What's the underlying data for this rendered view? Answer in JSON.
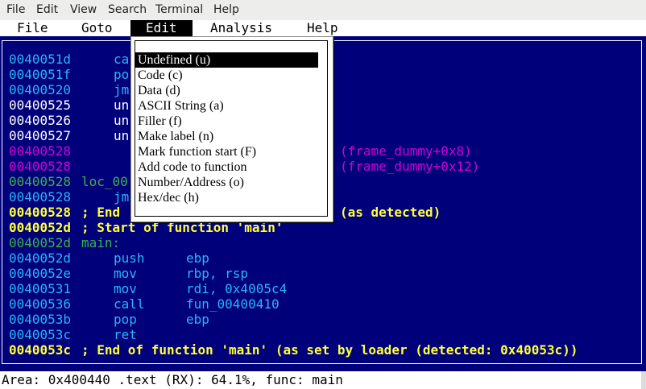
{
  "terminal_menu": [
    "File",
    "Edit",
    "View",
    "Search",
    "Terminal",
    "Help"
  ],
  "app_menu": [
    "File",
    "Goto",
    "Edit",
    "Analysis",
    "Help"
  ],
  "app_menu_active": "Edit",
  "edit_menu": [
    "Undefined (u)",
    "Code (c)",
    "Data (d)",
    "ASCII String (a)",
    "Filler (f)",
    "Make label (n)",
    "Mark function start (F)",
    "Add code to function",
    "Number/Address (o)",
    "Hex/dec (h)"
  ],
  "edit_menu_selected": "Undefined (u)",
  "listing": [
    {
      "addr": "0040051d",
      "text": "ca"
    },
    {
      "addr": "0040051f",
      "text": "po"
    },
    {
      "addr": "00400520",
      "text": "jm"
    },
    {
      "addr": "00400525",
      "text": "un"
    },
    {
      "addr": "00400526",
      "text": "un"
    },
    {
      "addr": "00400527",
      "text": "un"
    },
    {
      "addr": "00400528",
      "text": "(frame_dummy+0x8)"
    },
    {
      "addr": "00400528",
      "text": "(frame_dummy+0x12)"
    },
    {
      "addr": "00400528",
      "text": "loc_00"
    },
    {
      "addr": "00400528",
      "text": "jm"
    },
    {
      "addr": "00400528",
      "text": "; End",
      "tail": "(as detected)"
    },
    {
      "addr": "0040052d",
      "text": "; Start of function 'main'"
    },
    {
      "addr": "0040052d",
      "text": "main:"
    },
    {
      "addr": "0040052d",
      "mnem": "push",
      "ops": "ebp"
    },
    {
      "addr": "0040052e",
      "mnem": "mov",
      "ops": "rbp, rsp"
    },
    {
      "addr": "00400531",
      "mnem": "mov",
      "ops": "rdi, 0x4005c4"
    },
    {
      "addr": "00400536",
      "mnem": "call",
      "ops": "fun_00400410"
    },
    {
      "addr": "0040053b",
      "mnem": "pop",
      "ops": "ebp"
    },
    {
      "addr": "0040053c",
      "mnem": "ret",
      "ops": ""
    },
    {
      "addr": "0040053c",
      "text": "; End of function 'main' (as set by loader (detected: 0x40053c))"
    }
  ],
  "status": "Area: 0x400440 .text (RX): 64.1%, func: main"
}
